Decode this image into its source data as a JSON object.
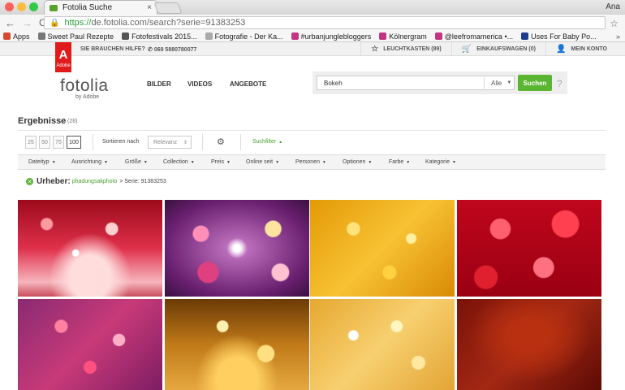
{
  "browser": {
    "tab_title": "Fotolia Suche",
    "tab_close": "×",
    "user": "Ana",
    "url_https": "https://",
    "url_rest": "de.fotolia.com/search?serie=91383253",
    "nav_back": "←",
    "nav_forward": "→",
    "reload": "C",
    "lock": "🔒",
    "star": "☆",
    "bookmarks": [
      {
        "label": "Apps",
        "color": "#d34b2f"
      },
      {
        "label": "Sweet Paul Rezepte",
        "color": "#777777"
      },
      {
        "label": "Fotofestivals 2015...",
        "color": "#555555"
      },
      {
        "label": "Fotografie - Der Ka...",
        "color": "#aaaaaa"
      },
      {
        "label": "#urbanjunglebloggers",
        "color": "#c13584"
      },
      {
        "label": "Kölnergram",
        "color": "#c13584"
      },
      {
        "label": "@leefromamerica •...",
        "color": "#c13584"
      },
      {
        "label": "Uses For Baby Po...",
        "color": "#1d3c8e"
      }
    ],
    "bookmarks_more": "»"
  },
  "sitebar": {
    "help": "SIE BRAUCHEN HILFE?",
    "phone": "069 5880780077",
    "lightbox": "LEUCHTKASTEN (89)",
    "cart": "EINKAUFSWAGEN (0)",
    "account": "MEIN KONTO",
    "adobe_label": "Adobe"
  },
  "header": {
    "logo": "fotolia",
    "logo_sub": "by Adobe",
    "nav": [
      "BILDER",
      "VIDEOS",
      "ANGEBOTE"
    ],
    "search_value": "Bokeh",
    "search_scope": "Alle",
    "search_button": "Suchen",
    "help_icon": "?"
  },
  "results": {
    "title": "Ergebnisse",
    "count": "(28)",
    "per_page": [
      "25",
      "50",
      "75",
      "100"
    ],
    "sort_label": "Sortieren nach",
    "sort_value": "Relevanz",
    "filter_toggle": "Suchfilter",
    "filters": [
      "Dateityp",
      "Ausrichtung",
      "Größe",
      "Collection",
      "Preis",
      "Online seit",
      "Personen",
      "Optionen",
      "Farbe",
      "Kategorie"
    ],
    "urheber_label": "Urheber:",
    "urheber_value": "phadungsakphoto",
    "serie_text": "> Serie: 91383253"
  }
}
